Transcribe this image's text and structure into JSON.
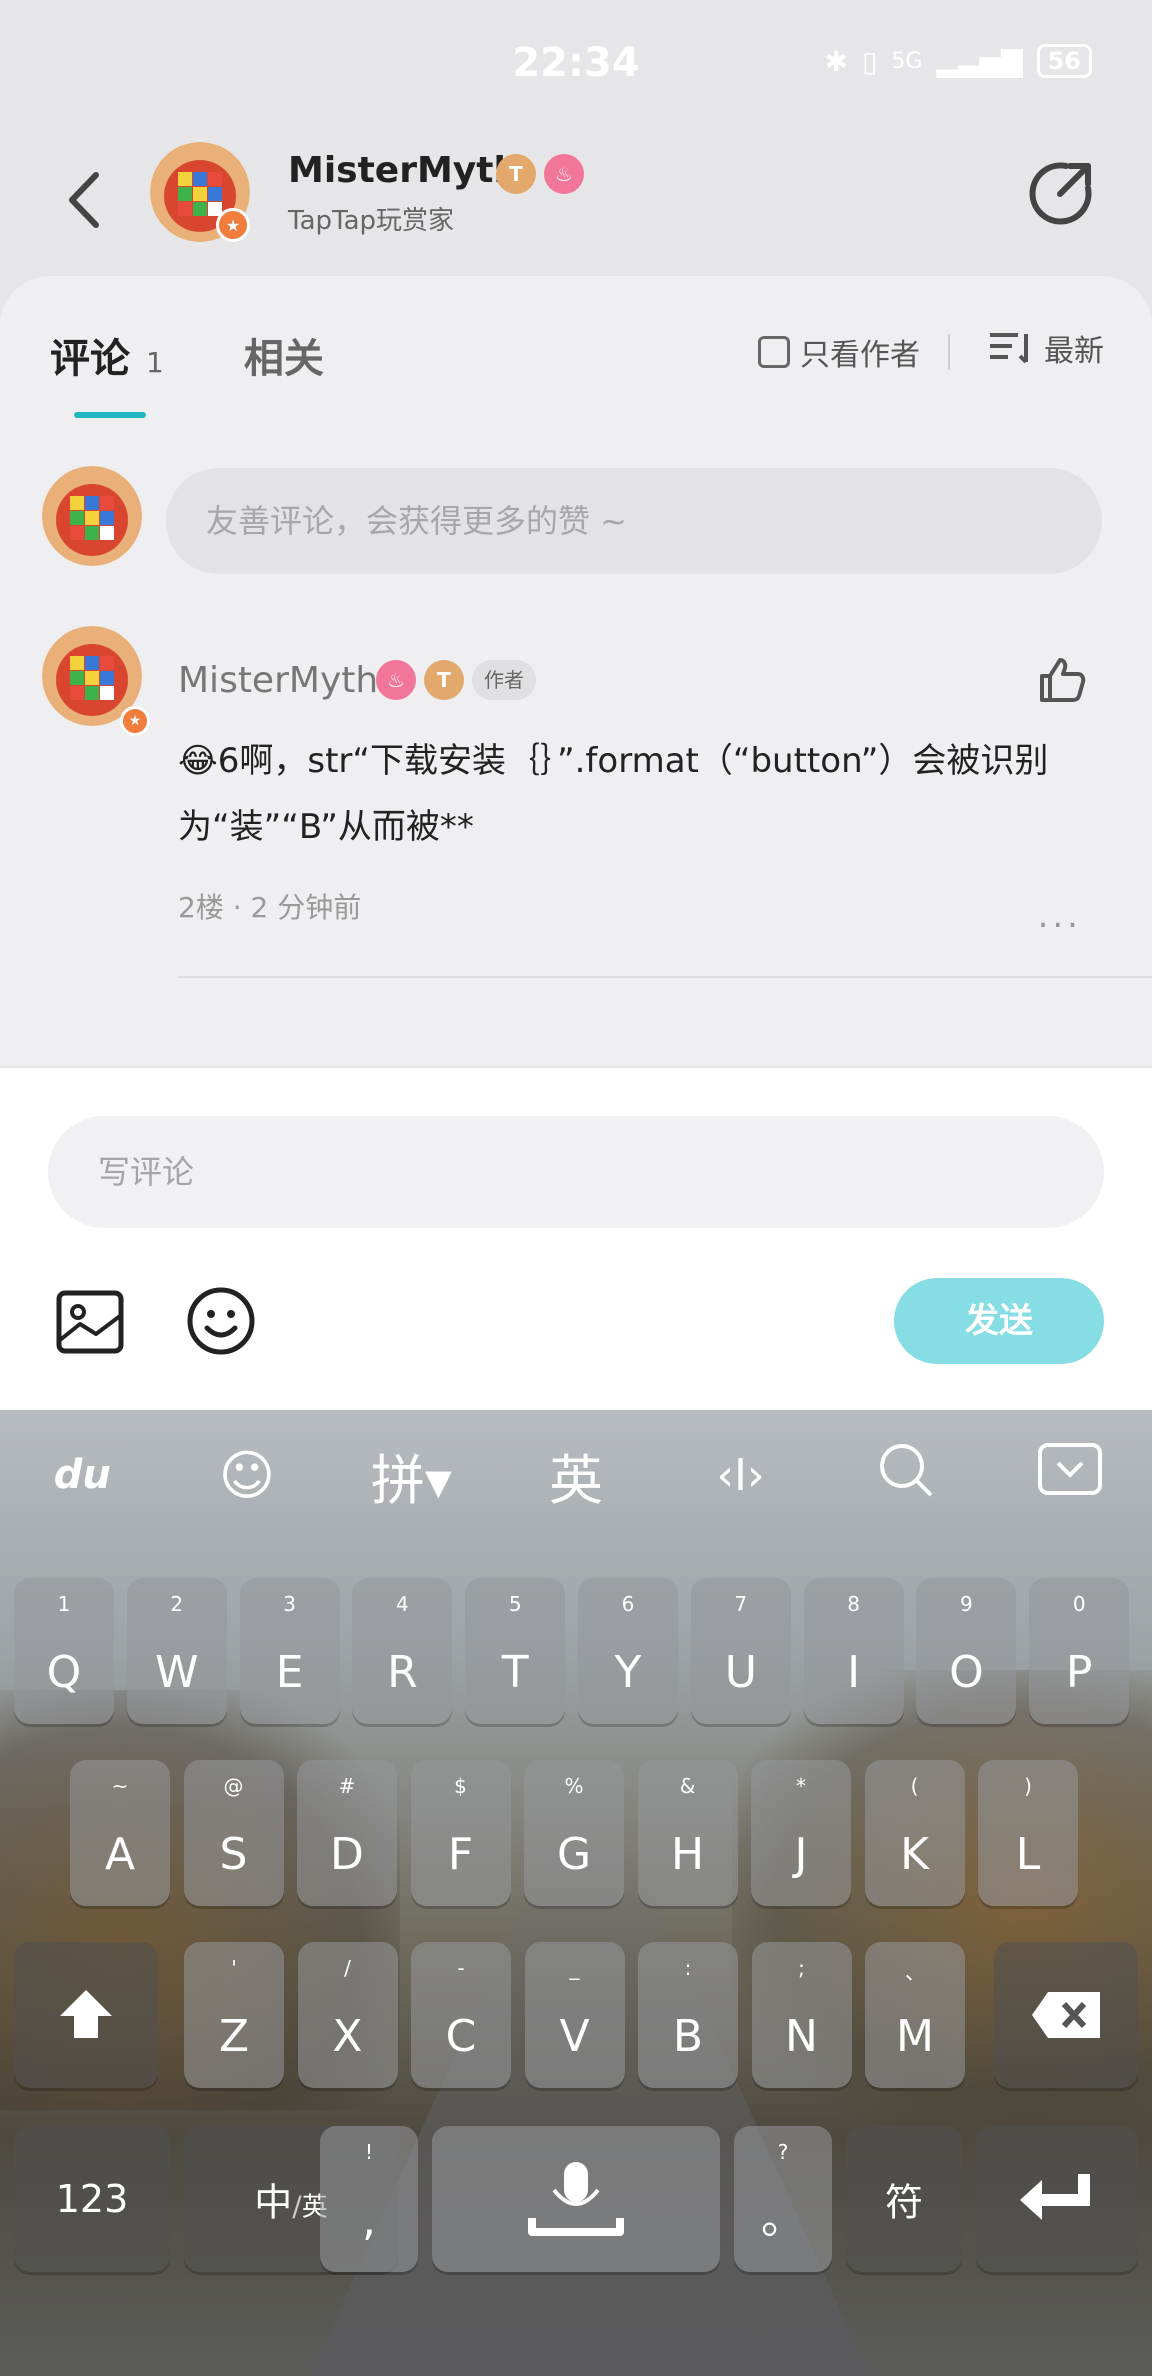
{
  "status_bar": {
    "time": "22:34",
    "battery": "56",
    "signal": "5G"
  },
  "header": {
    "username": "MisterMyth",
    "subtitle": "TapTap玩赏家",
    "level_badge": "T",
    "level_sub": "4"
  },
  "tabs": {
    "comments_label": "评论",
    "comments_count": "1",
    "related_label": "相关",
    "author_only_label": "只看作者",
    "sort_label": "最新"
  },
  "compose_prompt": "友善评论，会获得更多的赞 ~",
  "comment": {
    "username": "MisterMyth",
    "author_tag": "作者",
    "text": "😂6啊，str“下载安装｛｝”.format（“button”）会被识别为“装”“B”从而被**",
    "meta": "2楼 · 2 分钟前",
    "more": "..."
  },
  "reply": {
    "placeholder": "写评论",
    "send_label": "发送"
  },
  "keyboard": {
    "toolbar": [
      "du",
      "☺",
      "拼▾",
      "英",
      "‹I›",
      "search",
      "collapse"
    ],
    "row1": [
      [
        "1",
        "Q"
      ],
      [
        "2",
        "W"
      ],
      [
        "3",
        "E"
      ],
      [
        "4",
        "R"
      ],
      [
        "5",
        "T"
      ],
      [
        "6",
        "Y"
      ],
      [
        "7",
        "U"
      ],
      [
        "8",
        "I"
      ],
      [
        "9",
        "O"
      ],
      [
        "0",
        "P"
      ]
    ],
    "row2": [
      [
        "~",
        "A"
      ],
      [
        "@",
        "S"
      ],
      [
        "#",
        "D"
      ],
      [
        "$",
        "F"
      ],
      [
        "%",
        "G"
      ],
      [
        "&",
        "H"
      ],
      [
        "*",
        "J"
      ],
      [
        "(",
        "K"
      ],
      [
        ")",
        "L"
      ]
    ],
    "row3": [
      [
        "'",
        "Z"
      ],
      [
        "/",
        "X"
      ],
      [
        "-",
        "C"
      ],
      [
        "_",
        "V"
      ],
      [
        ":",
        "B"
      ],
      [
        ";",
        "N"
      ],
      [
        "、",
        "M"
      ]
    ],
    "key_123": "123",
    "key_lang_main": "中",
    "key_lang_sub": "英",
    "key_comma_hint": "!",
    "key_comma": ",",
    "key_period_hint": "?",
    "key_period": "。",
    "key_symbol": "符"
  },
  "colors": {
    "accent": "#1fb8c3",
    "send_button": "#86dde4"
  }
}
